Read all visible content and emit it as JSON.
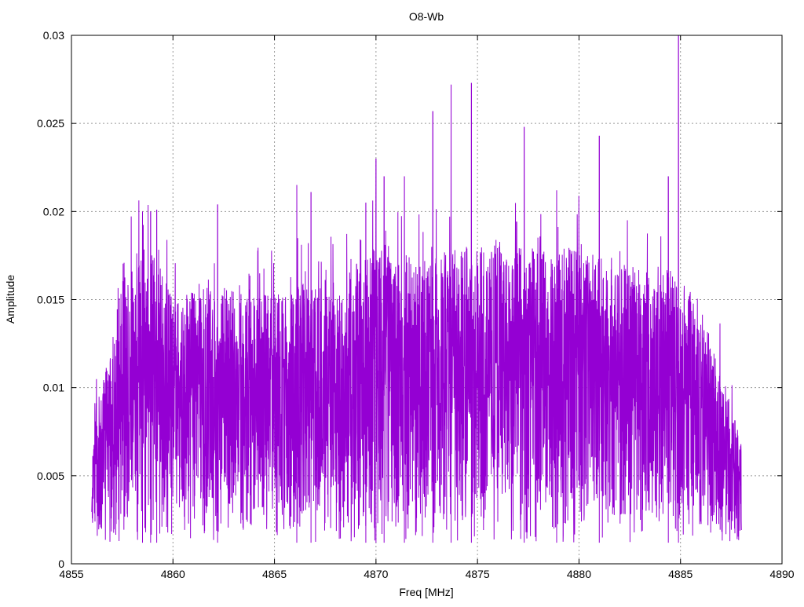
{
  "chart_data": {
    "type": "line",
    "title": "O8-Wb",
    "xlabel": "Freq [MHz]",
    "ylabel": "Amplitude",
    "xlim": [
      4855,
      4890
    ],
    "ylim": [
      0,
      0.03
    ],
    "xticks": [
      4855,
      4860,
      4865,
      4870,
      4875,
      4880,
      4885,
      4890
    ],
    "yticks": [
      0,
      0.005,
      0.01,
      0.015,
      0.02,
      0.025,
      0.03
    ],
    "xtick_labels": [
      "4855",
      "4860",
      "4865",
      "4870",
      "4875",
      "4880",
      "4885",
      "4890"
    ],
    "ytick_labels": [
      "0",
      "0.005",
      "0.01",
      "0.015",
      "0.02",
      "0.025",
      "0.03"
    ],
    "grid": true,
    "legend": "none",
    "colors": {
      "series": "#9400d3",
      "grid": "#999999",
      "axis": "#000000"
    },
    "series": [
      {
        "name": "",
        "x_range": [
          4856,
          4888
        ],
        "samples": 4000,
        "envelope": [
          [
            4856.0,
            0.004
          ],
          [
            4856.1,
            0.009
          ],
          [
            4856.5,
            0.01
          ],
          [
            4857.0,
            0.013
          ],
          [
            4857.5,
            0.016
          ],
          [
            4858.0,
            0.017
          ],
          [
            4858.5,
            0.018
          ],
          [
            4859.0,
            0.018
          ],
          [
            4860.0,
            0.015
          ],
          [
            4862.0,
            0.016
          ],
          [
            4864.0,
            0.015
          ],
          [
            4866.0,
            0.016
          ],
          [
            4868.0,
            0.016
          ],
          [
            4870.0,
            0.018
          ],
          [
            4872.0,
            0.017
          ],
          [
            4874.0,
            0.018
          ],
          [
            4876.0,
            0.018
          ],
          [
            4878.0,
            0.018
          ],
          [
            4880.0,
            0.018
          ],
          [
            4882.0,
            0.017
          ],
          [
            4884.0,
            0.017
          ],
          [
            4885.0,
            0.016
          ],
          [
            4886.0,
            0.015
          ],
          [
            4886.5,
            0.013
          ],
          [
            4887.0,
            0.011
          ],
          [
            4887.5,
            0.009
          ],
          [
            4888.0,
            0.007
          ]
        ],
        "floor": 0.0012,
        "peaks": [
          {
            "x": 4858.5,
            "y": 0.02
          },
          {
            "x": 4858.9,
            "y": 0.02
          },
          {
            "x": 4859.2,
            "y": 0.0201
          },
          {
            "x": 4862.2,
            "y": 0.0204
          },
          {
            "x": 4866.1,
            "y": 0.0215
          },
          {
            "x": 4866.8,
            "y": 0.0211
          },
          {
            "x": 4869.5,
            "y": 0.0205
          },
          {
            "x": 4870.0,
            "y": 0.023
          },
          {
            "x": 4870.4,
            "y": 0.022
          },
          {
            "x": 4871.4,
            "y": 0.022
          },
          {
            "x": 4872.8,
            "y": 0.0257
          },
          {
            "x": 4873.7,
            "y": 0.0272
          },
          {
            "x": 4874.7,
            "y": 0.0273
          },
          {
            "x": 4877.3,
            "y": 0.0248
          },
          {
            "x": 4878.9,
            "y": 0.0212
          },
          {
            "x": 4881.0,
            "y": 0.0243
          },
          {
            "x": 4884.4,
            "y": 0.022
          },
          {
            "x": 4884.9,
            "y": 0.03
          }
        ]
      }
    ]
  }
}
